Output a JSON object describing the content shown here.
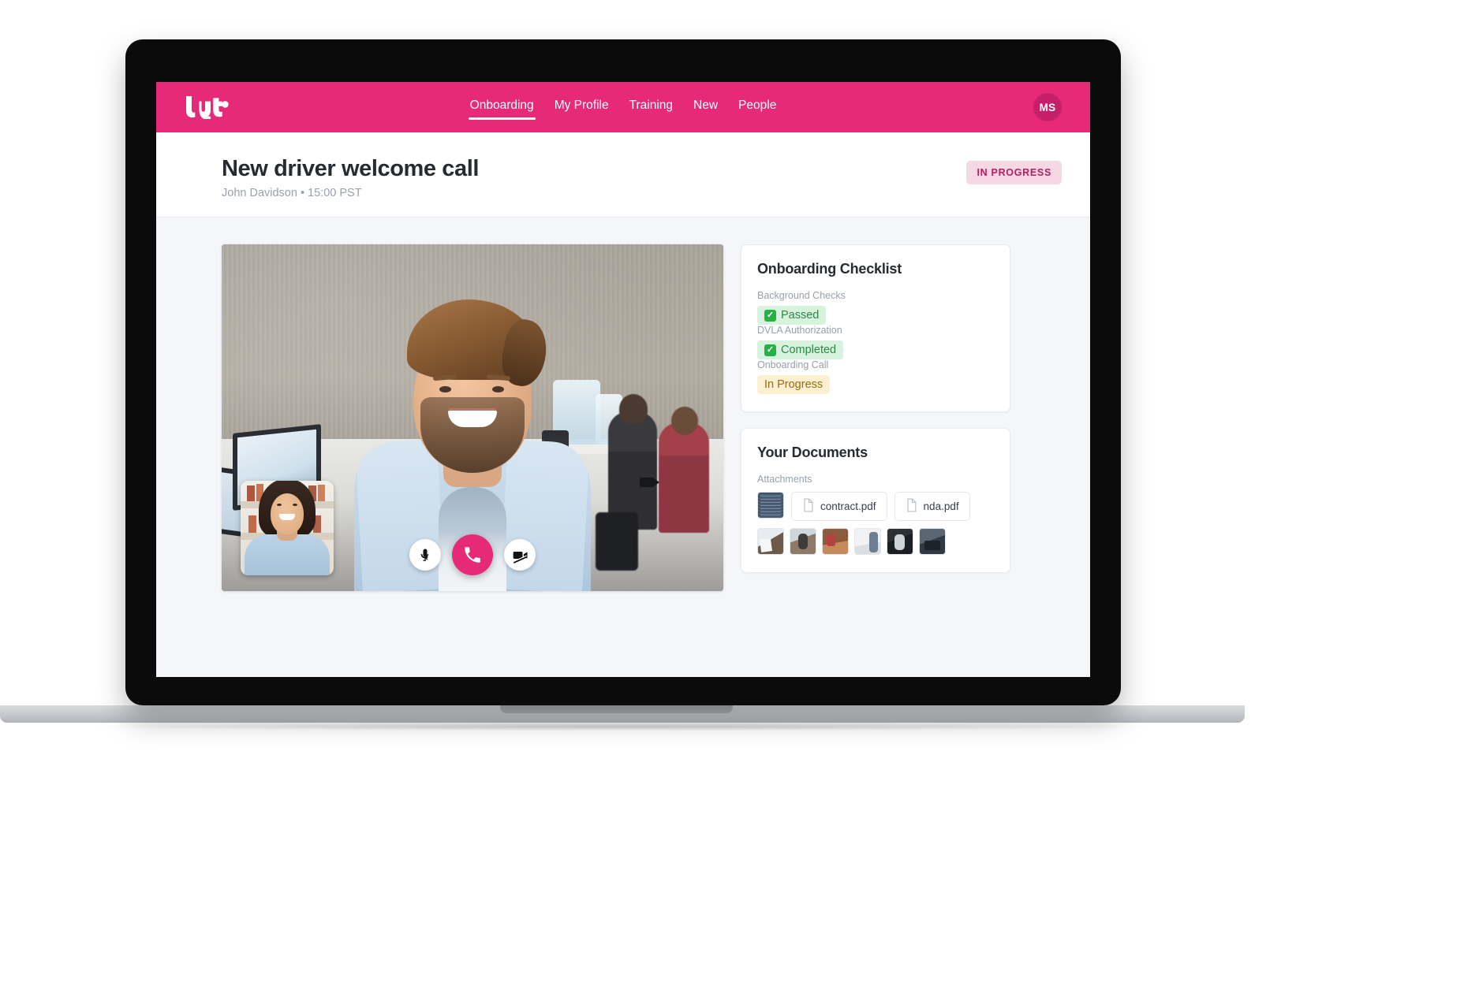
{
  "brand": {
    "name": "lyft",
    "primary_color": "#e72a78",
    "logo_icon": "lyft-wordmark"
  },
  "nav": {
    "items": [
      {
        "label": "Onboarding",
        "active": true
      },
      {
        "label": "My Profile",
        "active": false
      },
      {
        "label": "Training",
        "active": false
      },
      {
        "label": "New",
        "active": false
      },
      {
        "label": "People",
        "active": false
      }
    ],
    "avatar_initials": "MS"
  },
  "header": {
    "title": "New driver welcome call",
    "subtitle": "John Davidson • 15:00 PST",
    "status_badge": "IN PROGRESS",
    "status_badge_bg": "#f6d7e4",
    "status_badge_color": "#b81d61"
  },
  "call": {
    "controls": [
      {
        "name": "mute-microphone",
        "icon": "microphone-off-icon",
        "style": "light"
      },
      {
        "name": "end-call",
        "icon": "phone-icon",
        "style": "primary"
      },
      {
        "name": "stop-video",
        "icon": "video-off-icon",
        "style": "light"
      }
    ],
    "self_view_label": "self-view",
    "remote_view_label": "remote-video"
  },
  "checklist": {
    "title": "Onboarding Checklist",
    "items": [
      {
        "label": "Background Checks",
        "value": "Passed",
        "state": "done",
        "icon": "check-box-icon"
      },
      {
        "label": "DVLA Authorization",
        "value": "Completed",
        "state": "done",
        "icon": "check-box-icon"
      },
      {
        "label": "Onboarding Call",
        "value": "In Progress",
        "state": "pending",
        "icon": ""
      }
    ]
  },
  "documents": {
    "title": "Your Documents",
    "attachments_label": "Attachments",
    "files": [
      {
        "name": "contract.pdf",
        "icon": "file-icon"
      },
      {
        "name": "nda.pdf",
        "icon": "file-icon"
      }
    ],
    "image_thumbnails": 6
  }
}
